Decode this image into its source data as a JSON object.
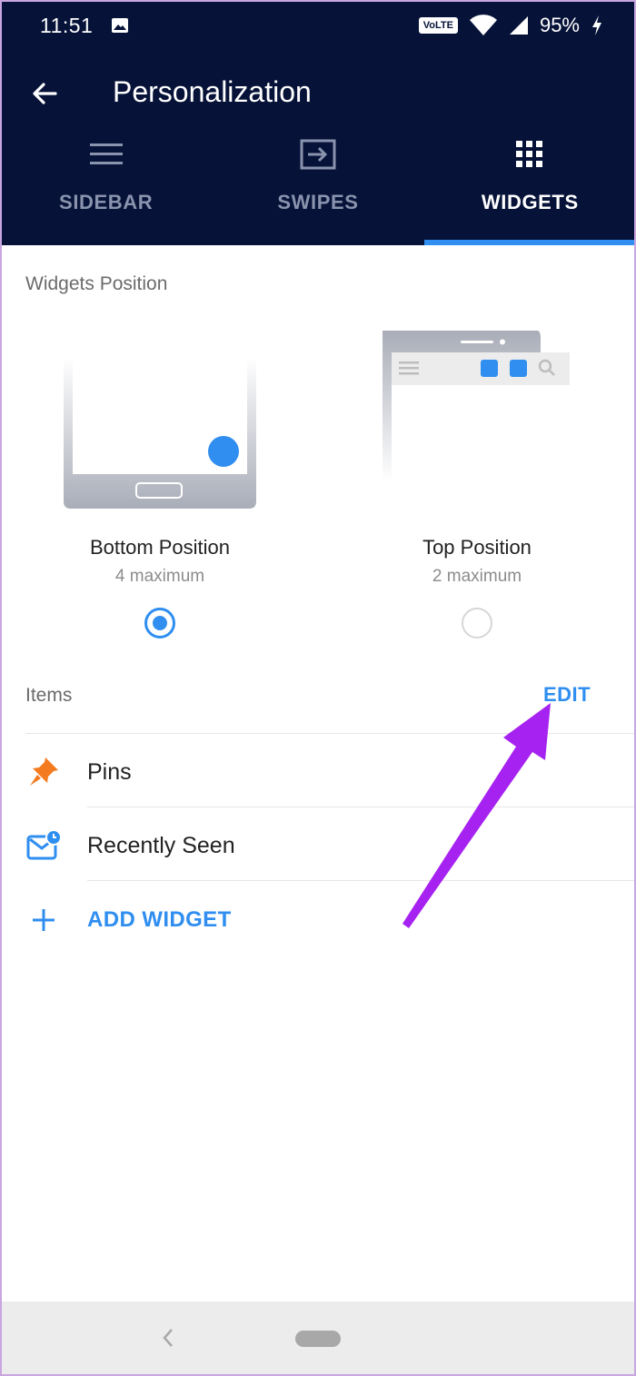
{
  "status_bar": {
    "time": "11:51",
    "network": "VoLTE",
    "battery": "95%",
    "icons": [
      "image-icon",
      "volte-icon",
      "wifi-icon",
      "signal-icon",
      "charging-icon"
    ]
  },
  "app_bar": {
    "title": "Personalization",
    "back_icon": "arrow-left-icon",
    "background": "#061238"
  },
  "tabs": [
    {
      "label": "SIDEBAR",
      "icon": "menu-icon",
      "active": false
    },
    {
      "label": "SWIPES",
      "icon": "swipe-icon",
      "active": false
    },
    {
      "label": "WIDGETS",
      "icon": "grid-icon",
      "active": true
    }
  ],
  "widgets_position": {
    "label": "Widgets Position",
    "options": [
      {
        "name": "Bottom Position",
        "max": "4 maximum",
        "selected": true
      },
      {
        "name": "Top Position",
        "max": "2 maximum",
        "selected": false
      }
    ]
  },
  "items": {
    "label": "Items",
    "edit_label": "EDIT",
    "list": [
      {
        "label": "Pins",
        "icon": "pin-icon"
      },
      {
        "label": "Recently Seen",
        "icon": "recent-mail-icon"
      }
    ],
    "add_label": "ADD WIDGET"
  },
  "colors": {
    "accent": "#2f8ef0",
    "pin": "#f47b20",
    "annotation_arrow": "#a622f0"
  }
}
